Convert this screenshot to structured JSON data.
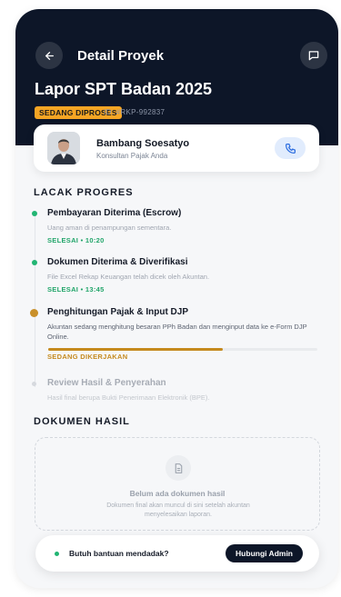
{
  "header": {
    "title": "Detail Proyek",
    "back_icon": "arrow-left-icon",
    "chat_icon": "message-square-icon"
  },
  "project": {
    "title": "Lapor SPT Badan 2025",
    "status": "SEDANG DIPROSES",
    "id": "ID: #RKP-992837"
  },
  "consultant": {
    "name": "Bambang Soesatyo",
    "role": "Konsultan Pajak Anda",
    "call_icon": "phone-icon"
  },
  "tracking": {
    "title": "LACAK PROGRES",
    "steps": [
      {
        "title": "Pembayaran Diterima (Escrow)",
        "desc": "Uang aman di penampungan sementara.",
        "status": "SELESAI • 10:20"
      },
      {
        "title": "Dokumen Diterima & Diverifikasi",
        "desc": "File Excel Rekap Keuangan telah dicek oleh Akuntan.",
        "status": "SELESAI • 13:45"
      },
      {
        "title": "Penghitungan Pajak & Input DJP",
        "desc": "Akuntan sedang menghitung besaran PPh Badan dan menginput data ke e-Form DJP Online.",
        "status": "SEDANG DIKERJAKAN",
        "progress": 0.65
      },
      {
        "title": "Review Hasil & Penyerahan",
        "desc": "Hasil final berupa Bukti Penerimaan Elektronik (BPE)."
      }
    ]
  },
  "documents": {
    "title": "DOKUMEN HASIL",
    "empty_icon": "document-icon",
    "empty_title": "Belum ada dokumen hasil",
    "empty_desc": "Dokumen final akan muncul di sini setelah akuntan menyelesaikan laporan."
  },
  "help": {
    "text": "Butuh bantuan mendadak?",
    "button": "Hubungi Admin"
  },
  "colors": {
    "header_bg": "#0d1628",
    "accent_orange": "#f5a524",
    "progress_gold": "#c58a1e",
    "success_green": "#22b573",
    "call_blue": "#2f6fe0"
  }
}
